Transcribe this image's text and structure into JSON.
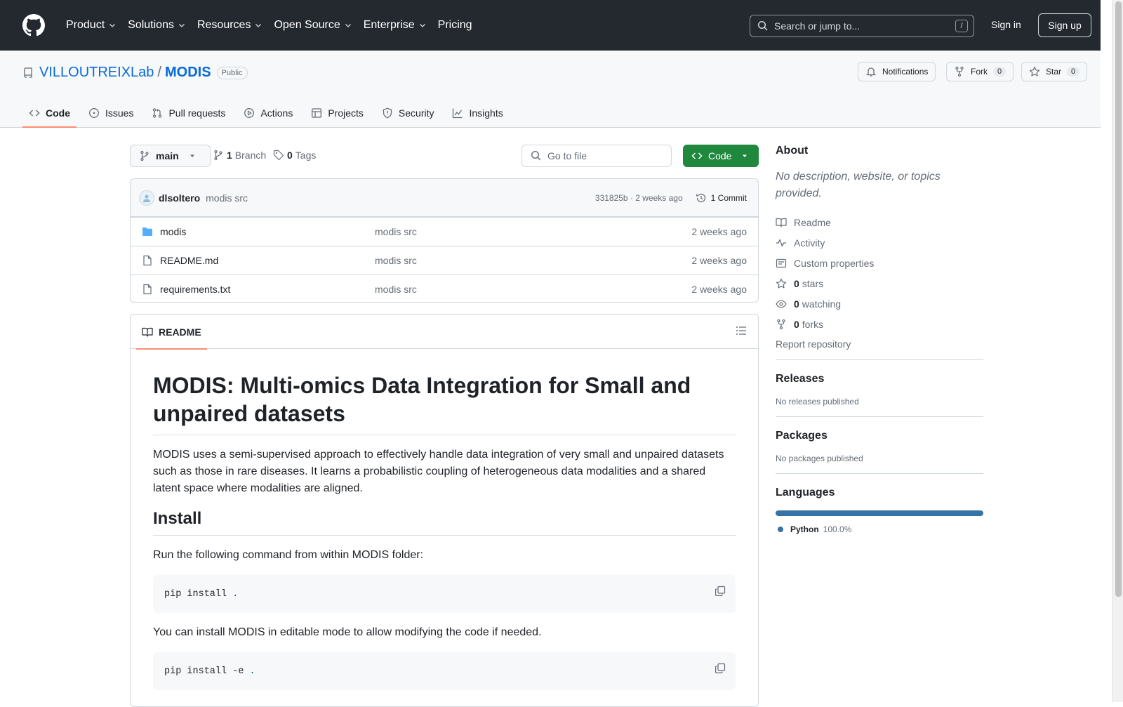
{
  "colors": {
    "header_bg": "#24292f",
    "accent": "#0969da",
    "code_green": "#1f883d",
    "tab_underline": "#fd8c73",
    "python": "#3572a5"
  },
  "header": {
    "nav": [
      "Product",
      "Solutions",
      "Resources",
      "Open Source",
      "Enterprise",
      "Pricing"
    ],
    "search_placeholder": "Search or jump to...",
    "search_kbd": "/",
    "sign_in": "Sign in",
    "sign_up": "Sign up"
  },
  "repo": {
    "owner": "VILLOUTREIXLab",
    "separator": "/",
    "name": "MODIS",
    "visibility": "Public",
    "notifications_label": "Notifications",
    "fork_label": "Fork",
    "fork_count": "0",
    "star_label": "Star",
    "star_count": "0"
  },
  "tabs": [
    "Code",
    "Issues",
    "Pull requests",
    "Actions",
    "Projects",
    "Security",
    "Insights"
  ],
  "toolbar": {
    "branch": "main",
    "branch_count": "1",
    "branch_label": "Branch",
    "tag_count": "0",
    "tag_label": "Tags",
    "go_to_file": "Go to file",
    "code_button": "Code"
  },
  "commit": {
    "author": "dlsoltero",
    "message": "modis src",
    "sha_time": "331825b · 2 weeks ago",
    "commits_label": "1 Commit"
  },
  "files": [
    {
      "type": "folder",
      "name": "modis",
      "message": "modis src",
      "date": "2 weeks ago"
    },
    {
      "type": "file",
      "name": "README.md",
      "message": "modis src",
      "date": "2 weeks ago"
    },
    {
      "type": "file",
      "name": "requirements.txt",
      "message": "modis src",
      "date": "2 weeks ago"
    }
  ],
  "readme": {
    "tab_label": "README",
    "h1": "MODIS: Multi-omics Data Integration for Small and unpaired datasets",
    "intro": "MODIS uses a semi-supervised approach to effectively handle data integration of very small and unpaired datasets such as those in rare diseases. It learns a probabilistic coupling of heterogeneous data modalities and a shared latent space where modalities are aligned.",
    "install_heading": "Install",
    "install_text": "Run the following command from within MODIS folder:",
    "code1": "pip install",
    "code1_dot": ".",
    "editable_text": "You can install MODIS in editable mode to allow modifying the code if needed.",
    "code2": "pip install -e",
    "code2_dot": "."
  },
  "sidebar": {
    "about_title": "About",
    "about_desc": "No description, website, or topics provided.",
    "readme": "Readme",
    "activity": "Activity",
    "custom_properties": "Custom properties",
    "stars_count": "0",
    "stars_label": "stars",
    "watching_count": "0",
    "watching_label": "watching",
    "forks_count": "0",
    "forks_label": "forks",
    "report": "Report repository",
    "releases_title": "Releases",
    "releases_text": "No releases published",
    "packages_title": "Packages",
    "packages_text": "No packages published",
    "languages_title": "Languages",
    "language_name": "Python",
    "language_pct": "100.0%",
    "language_share": 1.0
  }
}
